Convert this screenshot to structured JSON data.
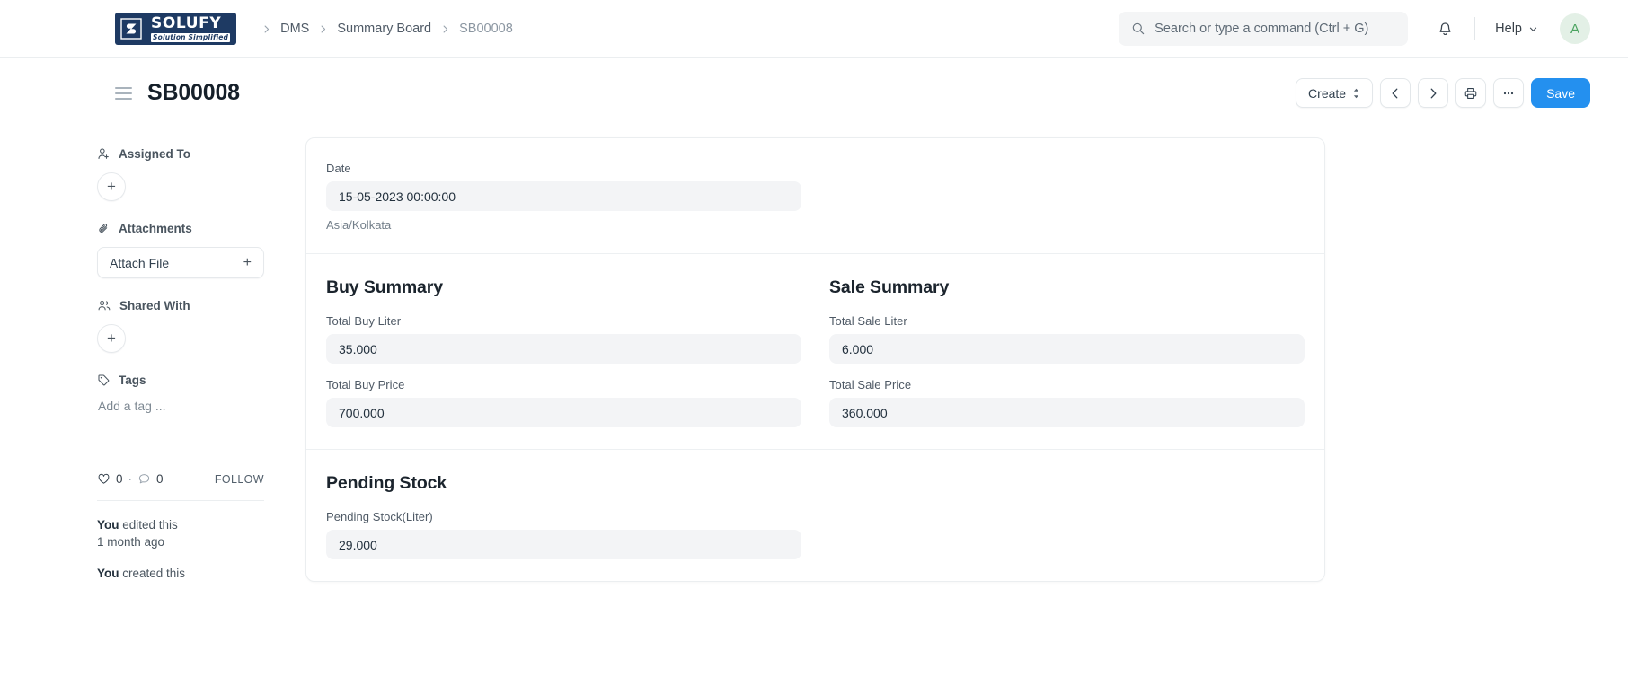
{
  "navbar": {
    "logo": {
      "name": "SOLUFY",
      "tagline": "Solution Simplified",
      "mark": "S"
    },
    "breadcrumb": [
      {
        "label": "DMS",
        "current": false
      },
      {
        "label": "Summary Board",
        "current": false
      },
      {
        "label": "SB00008",
        "current": true
      }
    ],
    "search": {
      "placeholder": "Search or type a command (Ctrl + G)",
      "value": ""
    },
    "help_label": "Help",
    "avatar_initial": "A"
  },
  "page_head": {
    "title": "SB00008",
    "create_label": "Create",
    "save_label": "Save"
  },
  "sidebar": {
    "assigned_to": {
      "label": "Assigned To",
      "add": "+"
    },
    "attachments": {
      "label": "Attachments",
      "attach_label": "Attach File",
      "add": "+"
    },
    "shared_with": {
      "label": "Shared With",
      "add": "+"
    },
    "tags": {
      "label": "Tags",
      "placeholder": "Add a tag ..."
    },
    "social": {
      "likes": "0",
      "separator": "·",
      "comments": "0",
      "follow_label": "FOLLOW"
    },
    "activity": [
      {
        "actor": "You",
        "action": " edited this",
        "time": "1 month ago"
      },
      {
        "actor": "You",
        "action": " created this",
        "time": ""
      }
    ]
  },
  "form": {
    "date_section": {
      "date_label": "Date",
      "date_value": "15-05-2023 00:00:00",
      "timezone": "Asia/Kolkata"
    },
    "buy_summary": {
      "title": "Buy Summary",
      "fields": [
        {
          "label": "Total Buy Liter",
          "value": "35.000"
        },
        {
          "label": "Total Buy Price",
          "value": "700.000"
        }
      ]
    },
    "sale_summary": {
      "title": "Sale Summary",
      "fields": [
        {
          "label": "Total Sale Liter",
          "value": "6.000"
        },
        {
          "label": "Total Sale Price",
          "value": "360.000"
        }
      ]
    },
    "pending_stock": {
      "title": "Pending Stock",
      "fields": [
        {
          "label": "Pending Stock(Liter)",
          "value": "29.000"
        }
      ]
    }
  },
  "colors": {
    "primary": "#2490ef",
    "logo_navy": "#1e3a63",
    "avatar_bg": "#e3f0e6",
    "avatar_fg": "#4aa35f"
  }
}
